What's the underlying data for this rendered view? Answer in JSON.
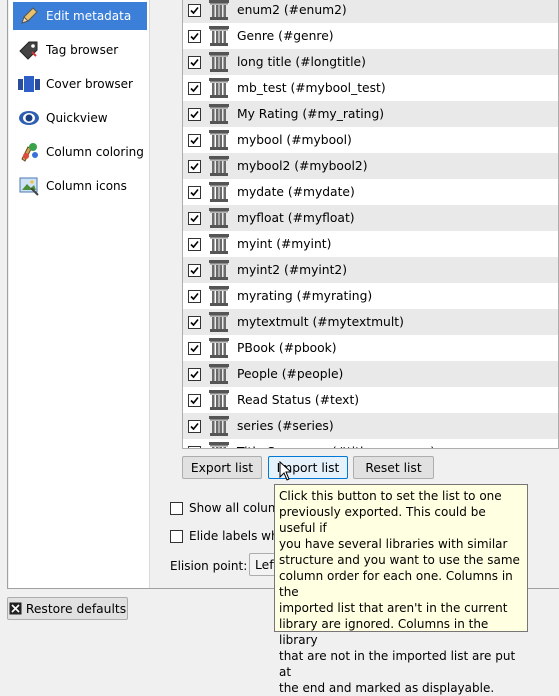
{
  "sidebar": {
    "items": [
      {
        "label": "Edit metadata",
        "icon": "pencil-icon",
        "selected": true
      },
      {
        "label": "Tag browser",
        "icon": "tag-icon"
      },
      {
        "label": "Cover browser",
        "icon": "cover-browser-icon"
      },
      {
        "label": "Quickview",
        "icon": "eye-icon"
      },
      {
        "label": "Column coloring",
        "icon": "palette-icon"
      },
      {
        "label": "Column icons",
        "icon": "image-icon"
      }
    ]
  },
  "columns": {
    "rows": [
      {
        "label": "enum2 (#enum2)",
        "checked": true
      },
      {
        "label": "Genre (#genre)",
        "checked": true
      },
      {
        "label": "long title (#longtitle)",
        "checked": true
      },
      {
        "label": "mb_test (#mybool_test)",
        "checked": true
      },
      {
        "label": "My Rating (#my_rating)",
        "checked": true
      },
      {
        "label": "mybool (#mybool)",
        "checked": true
      },
      {
        "label": "mybool2 (#mybool2)",
        "checked": true
      },
      {
        "label": "mydate (#mydate)",
        "checked": true
      },
      {
        "label": "myfloat (#myfloat)",
        "checked": true
      },
      {
        "label": "myint (#myint)",
        "checked": true
      },
      {
        "label": "myint2 (#myint2)",
        "checked": true
      },
      {
        "label": "myrating (#myrating)",
        "checked": true
      },
      {
        "label": "mytextmult (#mytextmult)",
        "checked": true
      },
      {
        "label": "PBook (#pbook)",
        "checked": true
      },
      {
        "label": "People (#people)",
        "checked": true
      },
      {
        "label": "Read Status (#text)",
        "checked": true
      },
      {
        "label": "series (#series)",
        "checked": true
      },
      {
        "label": "Title Sequence (#titlesequence)",
        "checked": true
      }
    ]
  },
  "buttons": {
    "export_list": "Export list",
    "import_list": "Import list",
    "reset_list": "Reset list",
    "restore_defaults": "Restore defaults"
  },
  "options": {
    "show_all": "Show all colum",
    "elide_labels": "Elide labels wh",
    "elision_point_label": "Elision point:",
    "elision_point_value": "Left"
  },
  "tooltip": {
    "text": "Click this button to set the list to one\npreviously exported. This could be useful if\nyou have several libraries with similar\nstructure and you want to use the same\ncolumn order for each one. Columns in the\nimported list that aren't in the current\nlibrary are ignored. Columns in the library\nthat are not in the imported list are put at\nthe end and marked as displayable."
  }
}
